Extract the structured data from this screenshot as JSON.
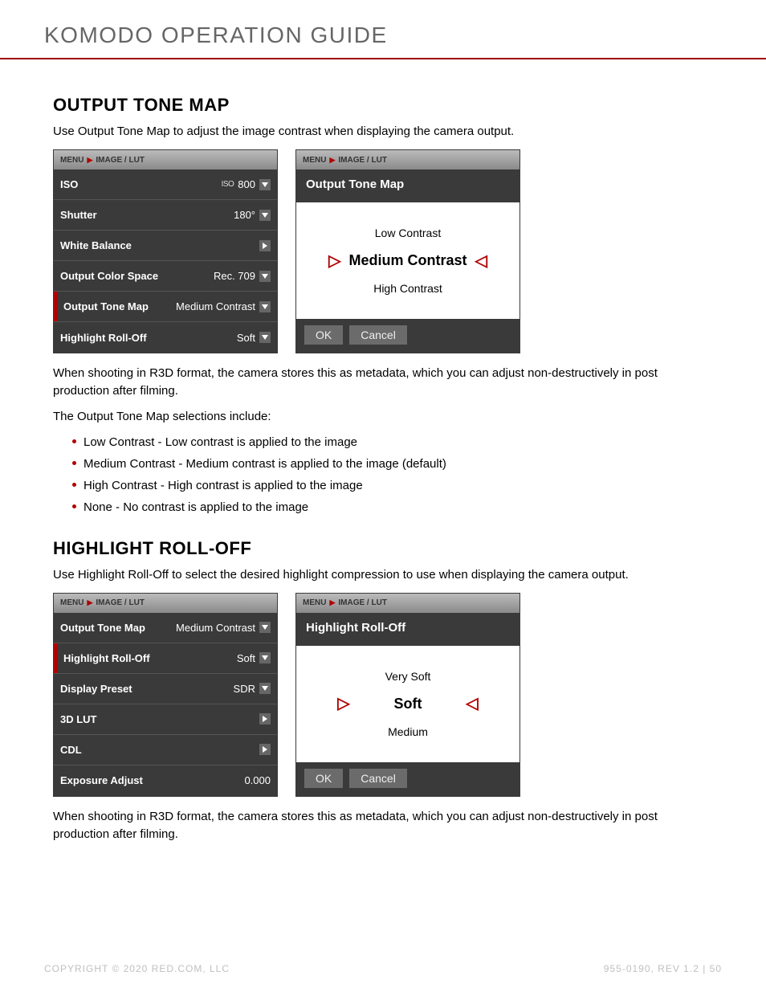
{
  "header": {
    "title": "KOMODO OPERATION GUIDE"
  },
  "sec1": {
    "heading": "OUTPUT TONE MAP",
    "intro": "Use Output Tone Map to adjust the image contrast when displaying the camera output.",
    "breadcrumb": {
      "p1": "MENU",
      "p2": "IMAGE / LUT"
    },
    "menu": [
      {
        "label": "ISO",
        "prefix": "ISO",
        "value": "800",
        "ctrl": "down",
        "selected": false
      },
      {
        "label": "Shutter",
        "value": "180°",
        "ctrl": "down",
        "selected": false
      },
      {
        "label": "White Balance",
        "value": "",
        "ctrl": "right",
        "selected": false
      },
      {
        "label": "Output Color Space",
        "value": "Rec. 709",
        "ctrl": "down",
        "selected": false
      },
      {
        "label": "Output Tone Map",
        "value": "Medium Contrast",
        "ctrl": "down",
        "selected": true
      },
      {
        "label": "Highlight Roll-Off",
        "value": "Soft",
        "ctrl": "down",
        "selected": false
      }
    ],
    "dialog": {
      "title": "Output Tone Map",
      "options": [
        {
          "label": "Low Contrast",
          "selected": false
        },
        {
          "label": "Medium Contrast",
          "selected": true
        },
        {
          "label": "High Contrast",
          "selected": false
        }
      ],
      "ok": "OK",
      "cancel": "Cancel"
    },
    "body_after": "When shooting in R3D format, the camera stores this as metadata, which you can adjust non-destructively in post production after filming.",
    "list_intro": "The Output Tone Map selections include:",
    "bullets": [
      "Low Contrast - Low contrast is applied to the image",
      "Medium Contrast - Medium contrast is applied to the image (default)",
      "High Contrast - High contrast is applied to the image",
      "None - No contrast is applied to the image"
    ]
  },
  "sec2": {
    "heading": "HIGHLIGHT ROLL-OFF",
    "intro": "Use Highlight Roll-Off to select the desired highlight compression to use when displaying the camera output.",
    "breadcrumb": {
      "p1": "MENU",
      "p2": "IMAGE / LUT"
    },
    "menu": [
      {
        "label": "Output Tone Map",
        "value": "Medium Contrast",
        "ctrl": "down",
        "selected": false
      },
      {
        "label": "Highlight Roll-Off",
        "value": "Soft",
        "ctrl": "down",
        "selected": true
      },
      {
        "label": "Display Preset",
        "value": "SDR",
        "ctrl": "down",
        "selected": false
      },
      {
        "label": "3D LUT",
        "value": "",
        "ctrl": "right",
        "selected": false
      },
      {
        "label": "CDL",
        "value": "",
        "ctrl": "right",
        "selected": false
      },
      {
        "label": "Exposure Adjust",
        "value": "0.000",
        "ctrl": "none",
        "selected": false
      }
    ],
    "dialog": {
      "title": "Highlight Roll-Off",
      "options": [
        {
          "label": "Very Soft",
          "selected": false
        },
        {
          "label": "Soft",
          "selected": true
        },
        {
          "label": "Medium",
          "selected": false
        }
      ],
      "ok": "OK",
      "cancel": "Cancel"
    },
    "body_after": "When shooting in R3D format, the camera stores this as metadata, which you can adjust non-destructively in post production after filming."
  },
  "footer": {
    "left": "COPYRIGHT © 2020 RED.COM, LLC",
    "right": "955-0190, REV 1.2  |  50"
  }
}
